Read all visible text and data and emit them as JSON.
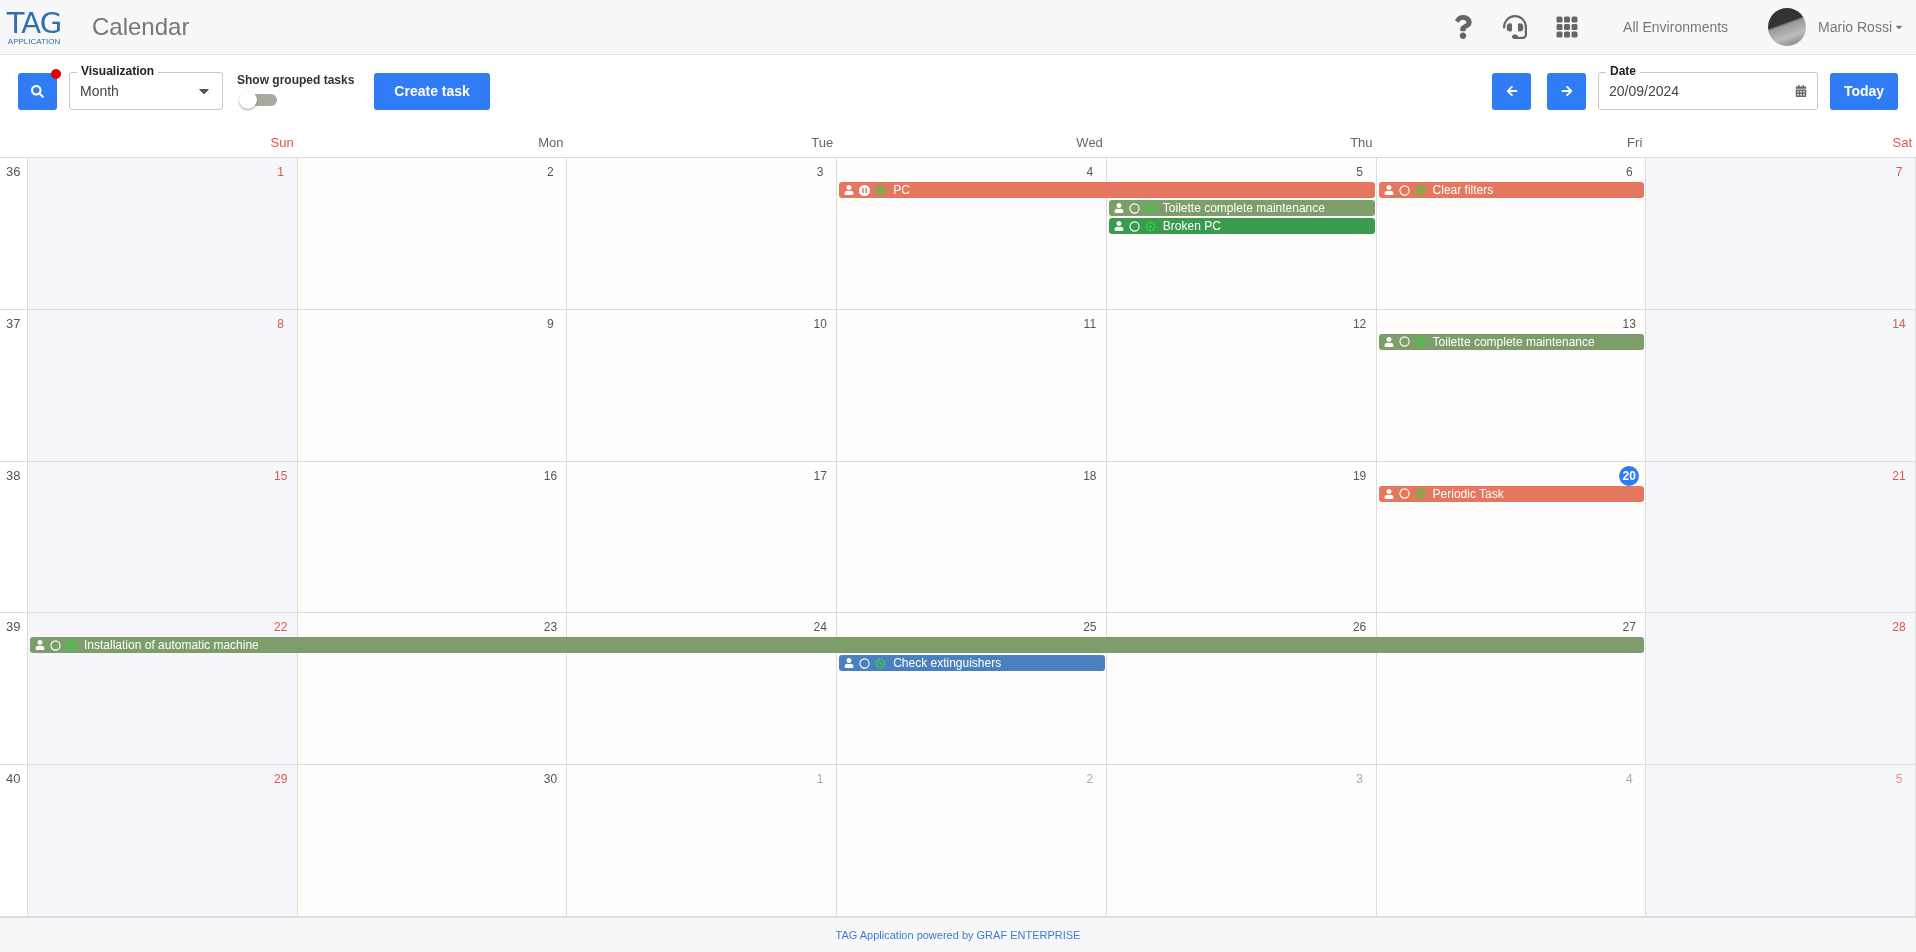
{
  "header": {
    "logo": {
      "name": "TAG",
      "sub": "APPLICATION"
    },
    "title": "Calendar",
    "environment": "All Environments",
    "user": "Mario Rossi"
  },
  "toolbar": {
    "filter_active": true,
    "visualization": {
      "label": "Visualization",
      "value": "Month"
    },
    "grouped_toggle": {
      "label": "Show grouped tasks",
      "on": false
    },
    "create_button": "Create task",
    "date": {
      "label": "Date",
      "value": "20/09/2024"
    },
    "today_button": "Today"
  },
  "day_names": [
    {
      "label": "Sun",
      "weekend": true
    },
    {
      "label": "Mon",
      "weekend": false
    },
    {
      "label": "Tue",
      "weekend": false
    },
    {
      "label": "Wed",
      "weekend": false
    },
    {
      "label": "Thu",
      "weekend": false
    },
    {
      "label": "Fri",
      "weekend": false
    },
    {
      "label": "Sat",
      "weekend": true
    }
  ],
  "weeks": [
    {
      "number": "36",
      "days": [
        {
          "label": "1",
          "today": false,
          "outside": false
        },
        {
          "label": "2",
          "today": false,
          "outside": false
        },
        {
          "label": "3",
          "today": false,
          "outside": false
        },
        {
          "label": "4",
          "today": false,
          "outside": false,
          "events": [
            {
              "kind": "task",
              "title": "PC",
              "color": "#e57760",
              "paused": true
            }
          ]
        },
        {
          "label": "5",
          "today": false,
          "outside": false,
          "events": [
            {
              "kind": "continued"
            },
            {
              "kind": "task",
              "title": "Toilette complete maintenance",
              "color": "#7d9e6a",
              "paused": false
            },
            {
              "kind": "task",
              "title": "Broken PC",
              "color": "#3a9a4e",
              "paused": false
            }
          ]
        },
        {
          "label": "6",
          "today": false,
          "outside": false,
          "events": [
            {
              "kind": "task",
              "title": "Clear filters",
              "color": "#e57760",
              "paused": false
            }
          ]
        },
        {
          "label": "7",
          "today": false,
          "outside": false
        }
      ]
    },
    {
      "number": "37",
      "days": [
        {
          "label": "8",
          "today": false,
          "outside": false
        },
        {
          "label": "9",
          "today": false,
          "outside": false
        },
        {
          "label": "10",
          "today": false,
          "outside": false
        },
        {
          "label": "11",
          "today": false,
          "outside": false
        },
        {
          "label": "12",
          "today": false,
          "outside": false
        },
        {
          "label": "13",
          "today": false,
          "outside": false,
          "events": [
            {
              "kind": "task",
              "title": "Toilette complete maintenance",
              "color": "#7d9e6a",
              "paused": false
            }
          ]
        },
        {
          "label": "14",
          "today": false,
          "outside": false
        }
      ]
    },
    {
      "number": "38",
      "days": [
        {
          "label": "15",
          "today": false,
          "outside": false
        },
        {
          "label": "16",
          "today": false,
          "outside": false
        },
        {
          "label": "17",
          "today": false,
          "outside": false
        },
        {
          "label": "18",
          "today": false,
          "outside": false
        },
        {
          "label": "19",
          "today": false,
          "outside": false
        },
        {
          "label": "20",
          "today": true,
          "outside": false,
          "events": [
            {
              "kind": "task",
              "title": "Periodic Task",
              "color": "#e57760",
              "paused": false
            }
          ]
        },
        {
          "label": "21",
          "today": false,
          "outside": false
        }
      ]
    },
    {
      "number": "39",
      "days": [
        {
          "label": "22",
          "today": false,
          "outside": false,
          "events": [
            {
              "kind": "task",
              "title": "Installation of automatic machine",
              "color": "#7d9e6a",
              "paused": false
            }
          ]
        },
        {
          "label": "23",
          "today": false,
          "outside": false,
          "events": [
            {
              "kind": "continued"
            }
          ]
        },
        {
          "label": "24",
          "today": false,
          "outside": false,
          "events": [
            {
              "kind": "continued"
            }
          ]
        },
        {
          "label": "25",
          "today": false,
          "outside": false,
          "events": [
            {
              "kind": "continued"
            },
            {
              "kind": "task",
              "title": "Check extinguishers",
              "color": "#4a80bf",
              "paused": false
            }
          ]
        },
        {
          "label": "26",
          "today": false,
          "outside": false,
          "events": [
            {
              "kind": "continued"
            }
          ]
        },
        {
          "label": "27",
          "today": false,
          "outside": false,
          "events": [
            {
              "kind": "continued"
            }
          ]
        },
        {
          "label": "28",
          "today": false,
          "outside": false
        }
      ]
    },
    {
      "number": "40",
      "days": [
        {
          "label": "29",
          "today": false,
          "outside": false
        },
        {
          "label": "30",
          "today": false,
          "outside": false
        },
        {
          "label": "1",
          "today": false,
          "outside": true
        },
        {
          "label": "2",
          "today": false,
          "outside": true
        },
        {
          "label": "3",
          "today": false,
          "outside": true
        },
        {
          "label": "4",
          "today": false,
          "outside": true
        },
        {
          "label": "5",
          "today": false,
          "outside": true
        }
      ]
    }
  ],
  "footer": "TAG Application powered by GRAF ENTERPRISE"
}
